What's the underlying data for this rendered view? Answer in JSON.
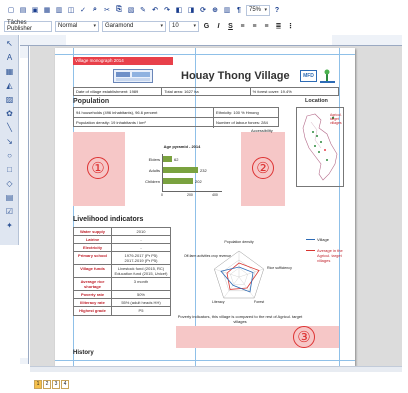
{
  "toolbar": {
    "style_name": "Tâches Publisher",
    "style_value": "Normal",
    "font": "Garamond",
    "size": "10",
    "zoom": "75%"
  },
  "document": {
    "header_band": "Village monograph 2014",
    "title": "Houay Thong Village",
    "logo_right_text": "MFD",
    "info": [
      "Date of village establishment: 1989",
      "Total area: 1627 ha",
      "% forest cover: 19.4%"
    ],
    "population_title": "Population",
    "population_rows": [
      [
        "94 households (496 inhabitants), 96.6 percent",
        "Ethnicity: 100 % Hmong"
      ],
      [
        "Population density: 19 inhabitants / km²",
        "Number of labour forces: 284"
      ]
    ],
    "location_title": "Location",
    "location_legend": "Agricul. target villages",
    "accessibility_label": "Accessibility",
    "age_chart_title": "Age pyramid - 2014",
    "age_categories": [
      "Elders",
      "Adults",
      "Children"
    ],
    "age_values": [
      "62",
      "232",
      "202"
    ],
    "age_ticks": [
      "0",
      "200",
      "400"
    ],
    "circle_1": "①",
    "circle_2": "②",
    "circle_3": "③",
    "livelihood_title": "Livelihood indicators",
    "livelihood_rows": [
      [
        "Water supply",
        "2010"
      ],
      [
        "Latrine",
        "-"
      ],
      [
        "Electricity",
        "-"
      ],
      [
        "Primary school",
        "1979-2017 (Pr P5)\n2017-2019 (Pr P5)"
      ],
      [
        "Village funds",
        "Livestock fund (2015, RC)\nEducation fund (2015, Unicef)"
      ],
      [
        "Average rice shortage",
        "3 month"
      ],
      [
        "Poverty rate",
        "50%"
      ],
      [
        "Illiteracy rate",
        "55% (adult heads HH)"
      ],
      [
        "Highest grade",
        "P5"
      ]
    ],
    "radar_axes": [
      "Population density",
      "Rice sufficiency",
      "Forest",
      "Literacy",
      "Off-farm activities crop revenue"
    ],
    "radar_caption": "Poverty indicators, this village is compared to the rest of Agricul. target villages",
    "radar_legend": [
      "Village",
      "Average in the Agricul. target villages"
    ],
    "history_title": "History"
  },
  "status": {
    "pages": [
      "1",
      "2",
      "3",
      "4"
    ]
  },
  "colors": {
    "accent_red": "#e8404a",
    "pink_placeholder": "#f6c7c7",
    "bar_green": "#7aa23f",
    "radar_village": "#2d6bb5",
    "radar_avg": "#d8342f"
  }
}
